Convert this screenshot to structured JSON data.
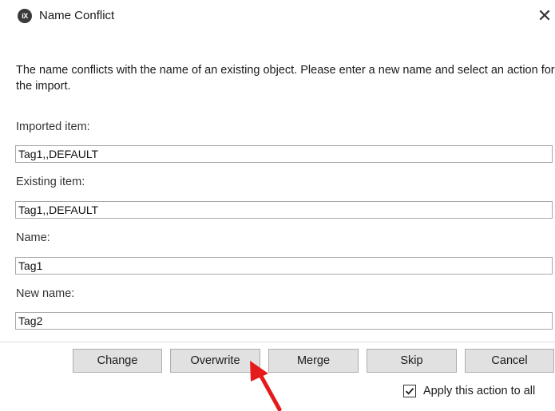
{
  "window": {
    "app_icon_text": "iX",
    "title": "Name Conflict",
    "close_glyph": "✕"
  },
  "message": "The name conflicts with the name of an existing object. Please enter a new name and select an action for the import.",
  "fields": {
    "imported_label": "Imported item:",
    "imported_value": "Tag1,,DEFAULT",
    "existing_label": "Existing item:",
    "existing_value": "Tag1,,DEFAULT",
    "name_label": "Name:",
    "name_value": "Tag1",
    "new_name_label": "New name:",
    "new_name_value": "Tag2"
  },
  "buttons": {
    "change": "Change",
    "overwrite": "Overwrite",
    "merge": "Merge",
    "skip": "Skip",
    "cancel": "Cancel"
  },
  "apply_all": {
    "label": "Apply this action to all",
    "checked": true
  },
  "icons": {
    "app": "app-logo-icon",
    "close": "close-icon",
    "check": "checkmark-icon",
    "arrow": "red-arrow-annotation"
  },
  "colors": {
    "button_bg": "#e1e1e1",
    "button_border": "#adadad",
    "arrow": "#e51b1b"
  }
}
